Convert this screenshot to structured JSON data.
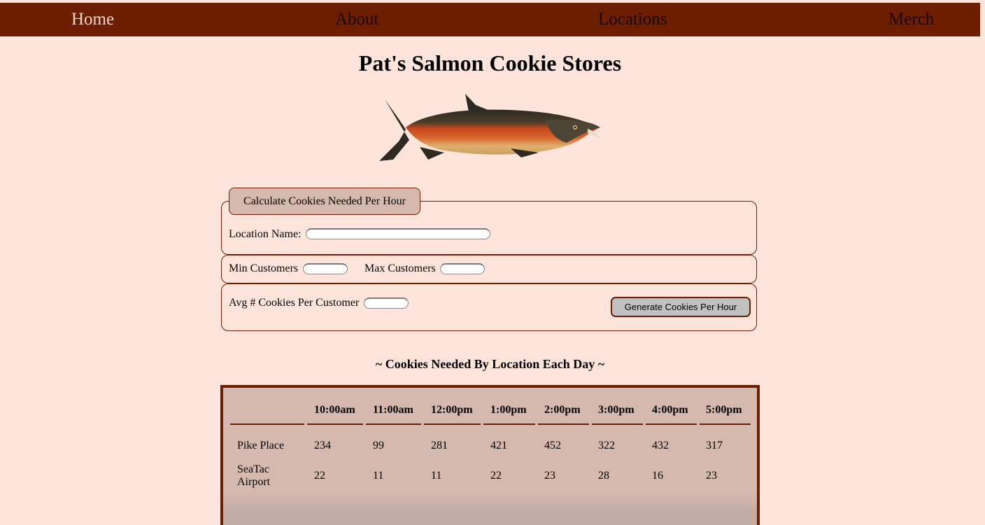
{
  "nav": {
    "home": "Home",
    "about": "About",
    "locations": "Locations",
    "merch": "Merch"
  },
  "page": {
    "title": "Pat's Salmon Cookie Stores",
    "image": "salmon-fish-illustration"
  },
  "form": {
    "legend": "Calculate Cookies Needed Per Hour",
    "location_label": "Location Name:",
    "location_value": "",
    "min_label": "Min Customers",
    "min_value": "",
    "max_label": "Max Customers",
    "max_value": "",
    "avg_label": "Avg # Cookies Per Customer",
    "avg_value": "",
    "submit_label": "Generate Cookies Per Hour"
  },
  "table": {
    "title": "~ Cookies Needed By Location Each Day ~",
    "headers": [
      "",
      "10:00am",
      "11:00am",
      "12:00pm",
      "1:00pm",
      "2:00pm",
      "3:00pm",
      "4:00pm",
      "5:00pm"
    ],
    "rows": [
      {
        "name": [
          "Pike Place"
        ],
        "values": [
          "234",
          "99",
          "281",
          "421",
          "452",
          "322",
          "432",
          "317"
        ]
      },
      {
        "name": [
          "SeaTac",
          "Airport"
        ],
        "values": [
          "22",
          "11",
          "11",
          "22",
          "23",
          "28",
          "16",
          "23"
        ]
      }
    ]
  },
  "colors": {
    "background": "#ffe4db",
    "nav": "#6e1e00",
    "table_bg": "#d6b9ae",
    "button": "#c1c1c1"
  }
}
